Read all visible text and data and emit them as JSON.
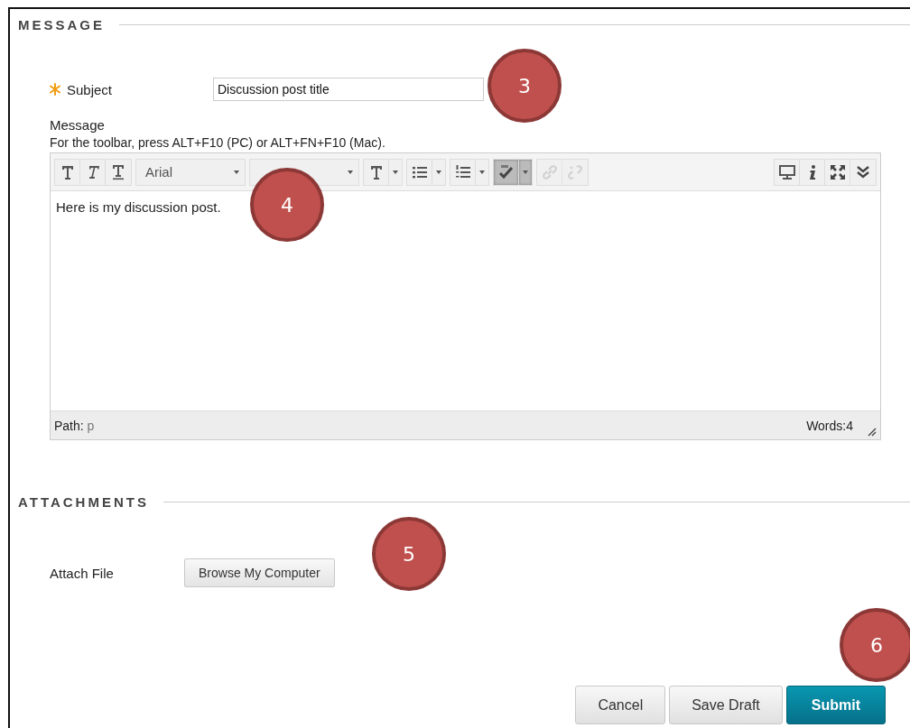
{
  "message_section": {
    "title": "MESSAGE",
    "subject": {
      "label": "Subject",
      "required": true,
      "value": "Discussion post title"
    },
    "message_label": "Message",
    "toolbar_hint": "For the toolbar, press ALT+F10 (PC) or ALT+FN+F10 (Mac).",
    "editor": {
      "toolbar": [
        {
          "kind": "bold",
          "on": false,
          "disabled": false
        },
        {
          "kind": "italic",
          "on": false,
          "disabled": false
        },
        {
          "kind": "underline",
          "on": false,
          "disabled": false
        },
        {
          "kind": "font",
          "value": "Arial"
        },
        {
          "kind": "size"
        },
        {
          "kind": "color",
          "on": false,
          "disabled": false
        },
        {
          "kind": "bullets",
          "on": false,
          "disabled": false
        },
        {
          "kind": "numbers",
          "on": false,
          "disabled": false
        },
        {
          "kind": "spellcheck",
          "on": true,
          "disabled": false
        },
        {
          "kind": "link",
          "on": false,
          "disabled": true
        },
        {
          "kind": "unlink",
          "on": false,
          "disabled": true
        },
        {
          "kind": "preview",
          "on": false,
          "disabled": false
        },
        {
          "kind": "info",
          "on": false,
          "disabled": false
        },
        {
          "kind": "fullscreen",
          "on": false,
          "disabled": false
        },
        {
          "kind": "more",
          "on": false,
          "disabled": false
        }
      ],
      "body": "Here is my discussion post.",
      "path_label": "Path:",
      "path_value": "p",
      "word_count": "Words:4"
    }
  },
  "attachments_section": {
    "title": "ATTACHMENTS",
    "attach_label": "Attach File",
    "browse_button": "Browse My Computer"
  },
  "buttons": [
    {
      "label": "Cancel",
      "kind": "secondary"
    },
    {
      "label": "Save Draft",
      "kind": "secondary"
    },
    {
      "label": "Submit",
      "kind": "primary"
    }
  ],
  "callouts": [
    {
      "label": "3"
    },
    {
      "label": "4"
    },
    {
      "label": "5"
    },
    {
      "label": "6"
    }
  ]
}
